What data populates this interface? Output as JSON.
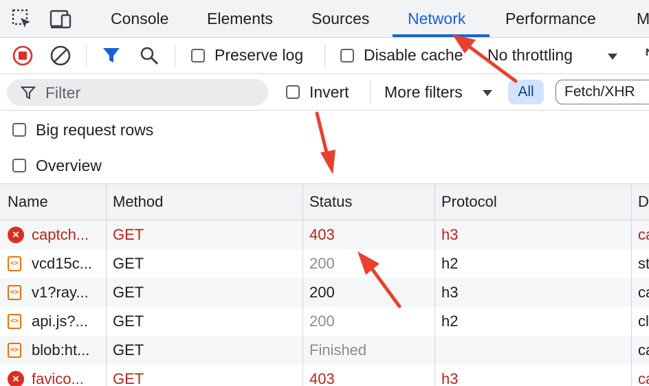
{
  "tabs": [
    {
      "label": "Console"
    },
    {
      "label": "Elements"
    },
    {
      "label": "Sources"
    },
    {
      "label": "Network",
      "active": true
    },
    {
      "label": "Performance"
    },
    {
      "label": "M"
    }
  ],
  "toolbar": {
    "preserve_log": "Preserve log",
    "disable_cache": "Disable cache",
    "throttling": "No throttling"
  },
  "filterbar": {
    "filter_placeholder": "Filter",
    "invert": "Invert",
    "more_filters": "More filters",
    "all": "All",
    "fetch_xhr": "Fetch/XHR"
  },
  "options": {
    "big_request_rows": "Big request rows",
    "overview": "Overview"
  },
  "table": {
    "columns": [
      "Name",
      "Method",
      "Status",
      "Protocol",
      "D"
    ],
    "rows": [
      {
        "icon": "error-icon",
        "name": "captch...",
        "method": "GET",
        "status": "403",
        "protocol": "h3",
        "domain": "ca",
        "kind": "error"
      },
      {
        "icon": "script-icon",
        "name": "vcd15c...",
        "method": "GET",
        "status": "200",
        "protocol": "h2",
        "domain": "st",
        "kind": "cached"
      },
      {
        "icon": "script-icon",
        "name": "v1?ray...",
        "method": "GET",
        "status": "200",
        "protocol": "h3",
        "domain": "ca",
        "kind": "ok"
      },
      {
        "icon": "script-icon",
        "name": "api.js?...",
        "method": "GET",
        "status": "200",
        "protocol": "h2",
        "domain": "cl",
        "kind": "cached"
      },
      {
        "icon": "script-icon",
        "name": "blob:ht...",
        "method": "GET",
        "status": "Finished",
        "protocol": "",
        "domain": "ca",
        "kind": "finished"
      },
      {
        "icon": "error-icon",
        "name": "favico...",
        "method": "GET",
        "status": "403",
        "protocol": "h3",
        "domain": "ca",
        "kind": "error"
      }
    ]
  },
  "colors": {
    "accent": "#1a62d2",
    "error": "#b3261e",
    "annotation_arrow": "#e8412f"
  }
}
